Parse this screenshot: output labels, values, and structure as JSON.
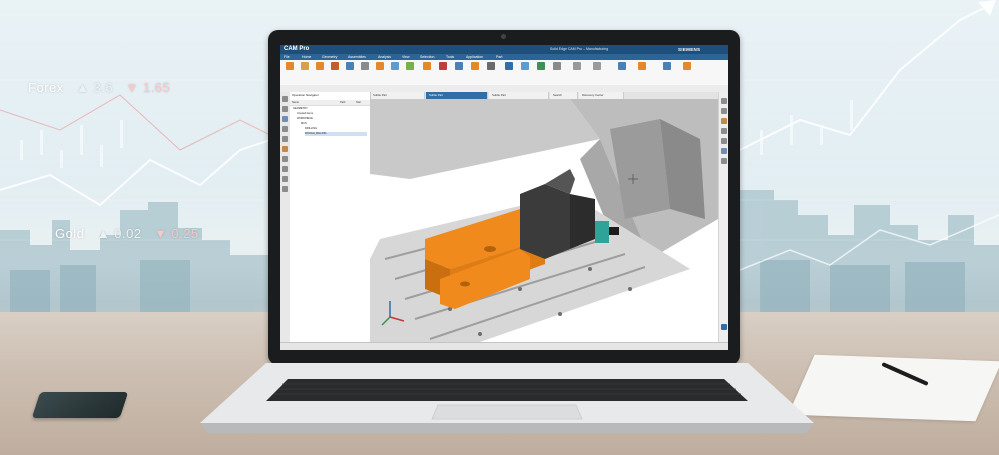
{
  "background": {
    "forex_label": "Forex",
    "forex_up": "▲ 3.6",
    "forex_down": "▼ 1.65",
    "gold_label": "Gold",
    "gold_up": "▲ 0.02",
    "gold_down": "▼ 0.25"
  },
  "app": {
    "name": "CAM Pro",
    "window_title": "Solid Edge CAM Pro – Manufacturing",
    "brand": "SIEMENS",
    "menu": [
      "File",
      "Home",
      "Geometry",
      "Assemblies",
      "Analysis",
      "View",
      "Selection",
      "Tools",
      "Application",
      "Part"
    ],
    "tabs": [
      "Subtle Part",
      "Subtle Part",
      "Subtle Part",
      "Search",
      "Discovery Center"
    ],
    "navigator_title": "Operation Navigator",
    "navigator_cols": [
      "Name",
      "Path",
      "Stat"
    ],
    "tree": [
      "GEOMETRY",
      "Unused Items",
      "WORKPIECE",
      "MCS",
      "DRILLING",
      "ROUGH_MILLING"
    ],
    "colors": {
      "titlebar": "#1d4f7a",
      "menubar": "#2c6496",
      "part": "#f08a1c",
      "fixture": "#3b3b3b",
      "table": "#d7d7d7"
    }
  }
}
